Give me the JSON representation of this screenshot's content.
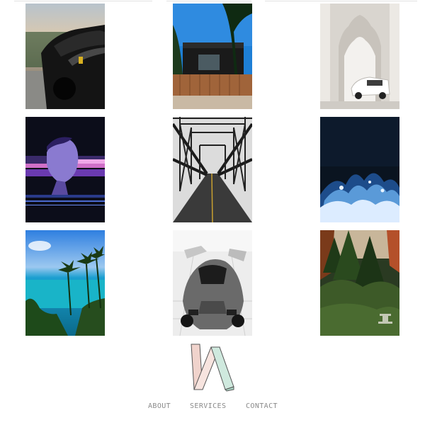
{
  "gallery": {
    "photos": [
      {
        "subject": "black sports car parked by the coast",
        "icon": "car-photo"
      },
      {
        "subject": "modern house with palm trees and wooden fence",
        "icon": "house-photo"
      },
      {
        "subject": "white car beneath ornate white arches",
        "icon": "arches-photo"
      },
      {
        "subject": "glitch art of a classical bust in purple",
        "icon": "bust-photo"
      },
      {
        "subject": "steel truss bridge with road perspective",
        "icon": "bridge-photo"
      },
      {
        "subject": "crashing wave in dark blue water",
        "icon": "wave-photo"
      },
      {
        "subject": "tropical coastline with turquoise sea and palms",
        "icon": "coast-photo"
      },
      {
        "subject": "grey supercar in a showroom",
        "icon": "supercar-photo"
      },
      {
        "subject": "lush forest garden with stone lantern",
        "icon": "forest-photo"
      }
    ]
  },
  "logo": {
    "icon": "monogram-logo",
    "colors": [
      "#f0d3cc",
      "#cfe9de"
    ]
  },
  "nav": {
    "about": "ABOUT",
    "services": "SERVICES",
    "contact": "CONTACT"
  }
}
